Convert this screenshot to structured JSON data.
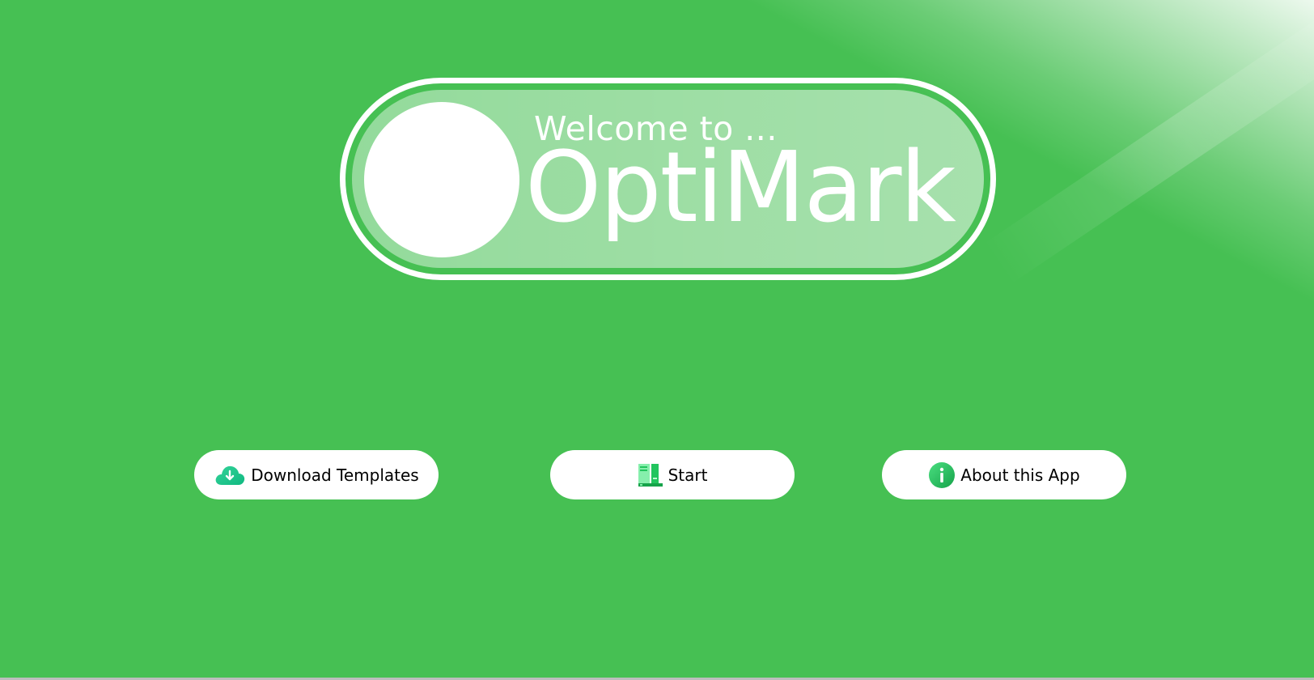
{
  "welcome": {
    "greeting": "Welcome to ...",
    "app_name": "OptiMark"
  },
  "buttons": {
    "download_label": "Download Templates",
    "download_icon": "cloud-download-icon",
    "start_label": "Start",
    "start_icon": "book-icon",
    "about_label": "About this App",
    "about_icon": "info-icon"
  },
  "colors": {
    "background": "#46c053",
    "banner_border": "#ffffff",
    "button_bg": "#ffffff",
    "icon_green": "#22c55e",
    "icon_teal": "#1dbf8f"
  }
}
